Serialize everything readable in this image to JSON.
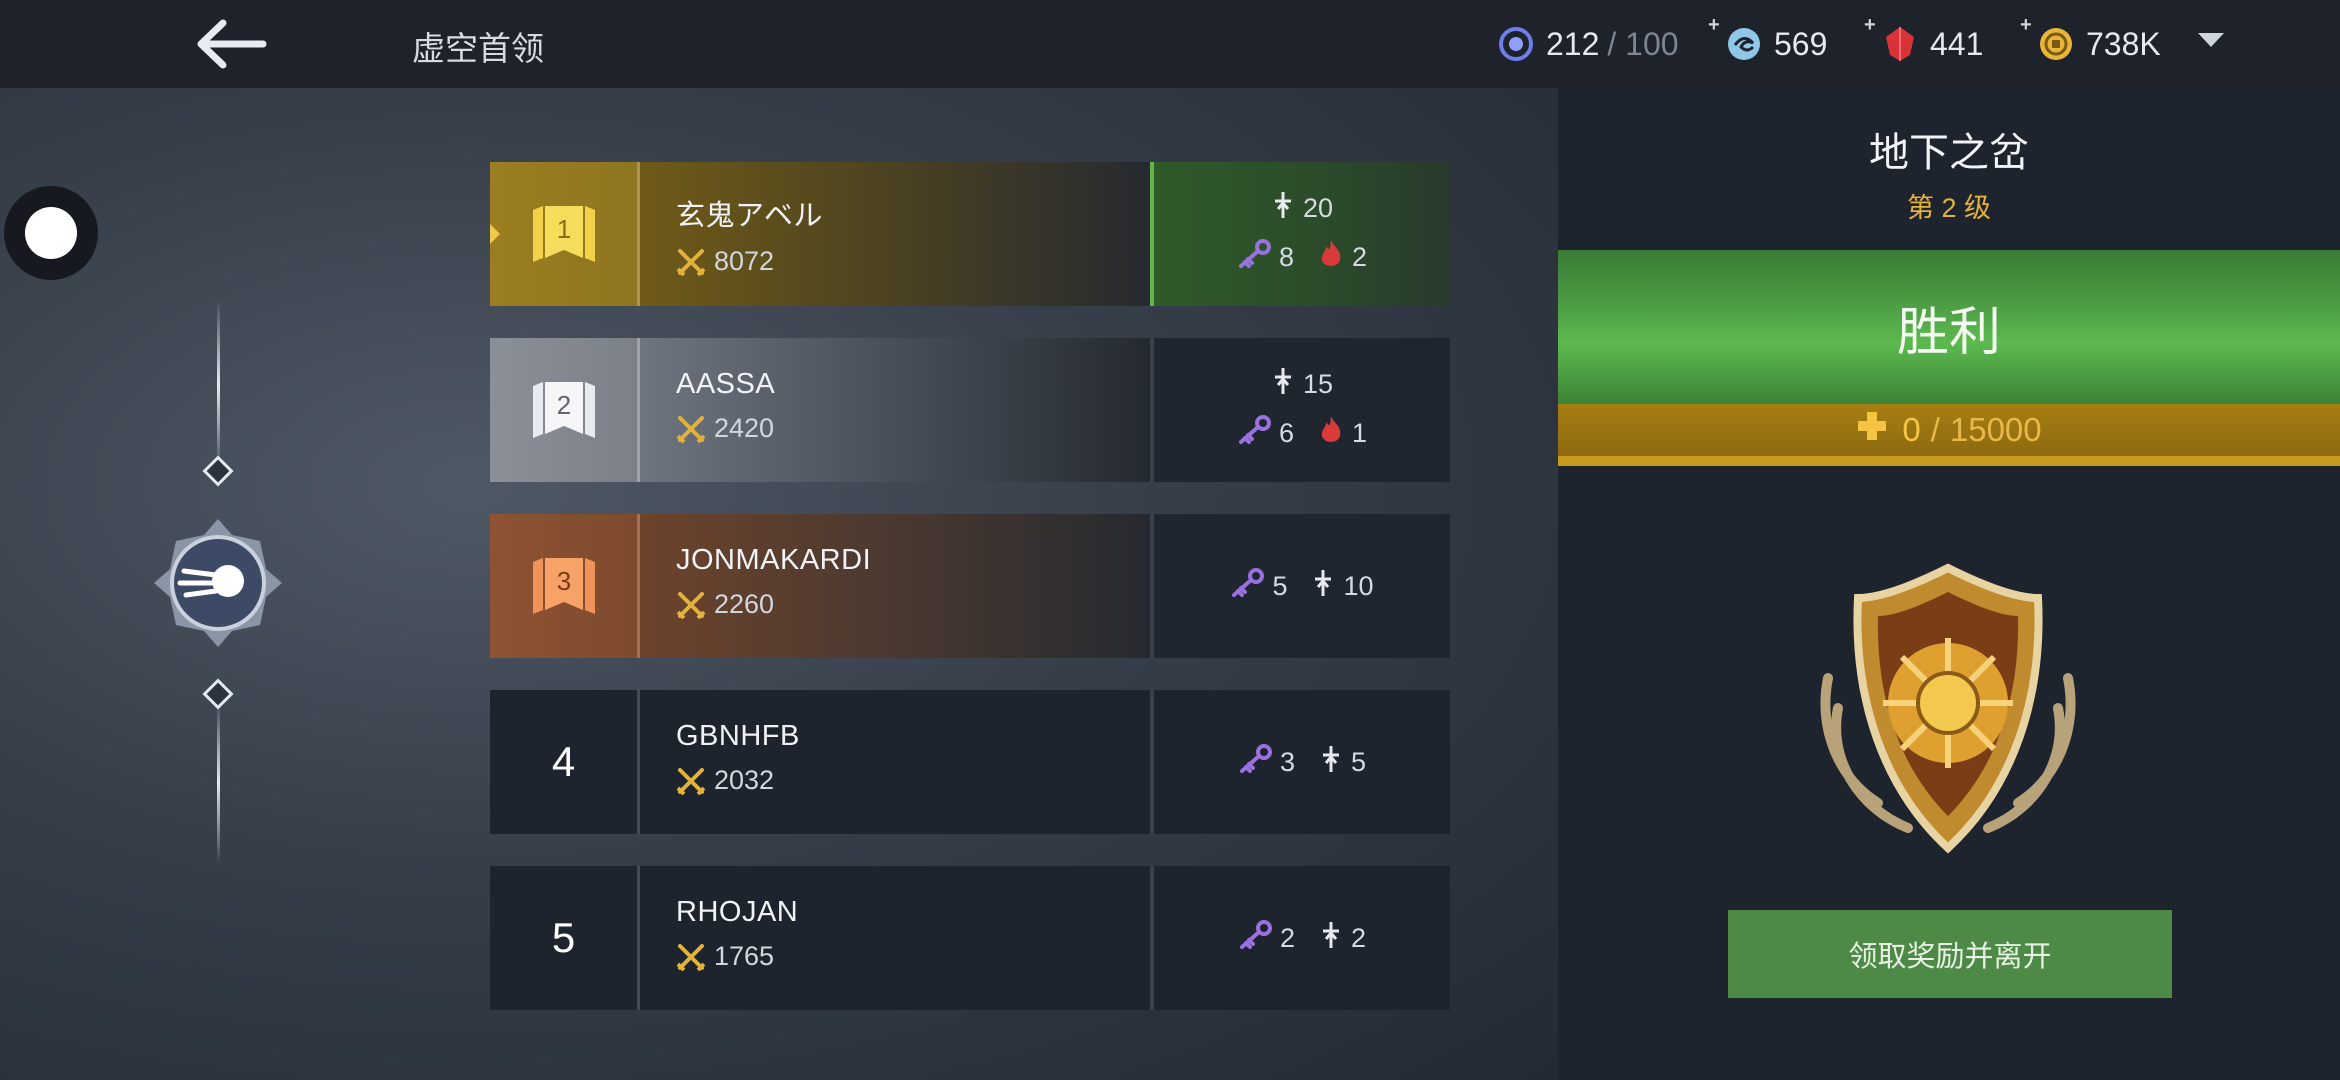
{
  "header": {
    "title": "虚空首领",
    "resources": [
      {
        "icon": "void-energy-icon",
        "value": "212",
        "suffix": "/ 100",
        "plus": false
      },
      {
        "icon": "swirl-orb-icon",
        "value": "569",
        "plus": true
      },
      {
        "icon": "red-gem-icon",
        "value": "441",
        "plus": true
      },
      {
        "icon": "gold-coin-icon",
        "value": "738K",
        "plus": true
      }
    ]
  },
  "ranking": [
    {
      "rank": "1",
      "name": "玄鬼アベル",
      "power": "8072",
      "stats_top": [
        {
          "icon": "sword-icon",
          "value": "20"
        }
      ],
      "stats_bottom": [
        {
          "icon": "key-icon",
          "value": "8"
        },
        {
          "icon": "flame-icon",
          "value": "2"
        }
      ]
    },
    {
      "rank": "2",
      "name": "AASSA",
      "power": "2420",
      "stats_top": [
        {
          "icon": "sword-icon",
          "value": "15"
        }
      ],
      "stats_bottom": [
        {
          "icon": "key-icon",
          "value": "6"
        },
        {
          "icon": "flame-icon",
          "value": "1"
        }
      ]
    },
    {
      "rank": "3",
      "name": "JONMAKARDI",
      "power": "2260",
      "stats_top": [
        {
          "icon": "key-icon",
          "value": "5"
        },
        {
          "icon": "sword-icon",
          "value": "10"
        }
      ]
    },
    {
      "rank": "4",
      "name": "GBNHFB",
      "power": "2032",
      "stats_top": [
        {
          "icon": "key-icon",
          "value": "3"
        },
        {
          "icon": "sword-icon",
          "value": "5"
        }
      ]
    },
    {
      "rank": "5",
      "name": "RHOJAN",
      "power": "1765",
      "stats_top": [
        {
          "icon": "key-icon",
          "value": "2"
        },
        {
          "icon": "sword-icon",
          "value": "2"
        }
      ]
    }
  ],
  "boss": {
    "name": "地下之岔",
    "level": "第 2 级",
    "result": "胜利",
    "progress_current": "0",
    "progress_sep": "/",
    "progress_max": "15000"
  },
  "actions": {
    "claim_label": "领取奖励并离开"
  },
  "colors": {
    "accent_gold": "#e3b23c",
    "victory_green": "#5cba4f",
    "button_green": "#4d8a46"
  }
}
